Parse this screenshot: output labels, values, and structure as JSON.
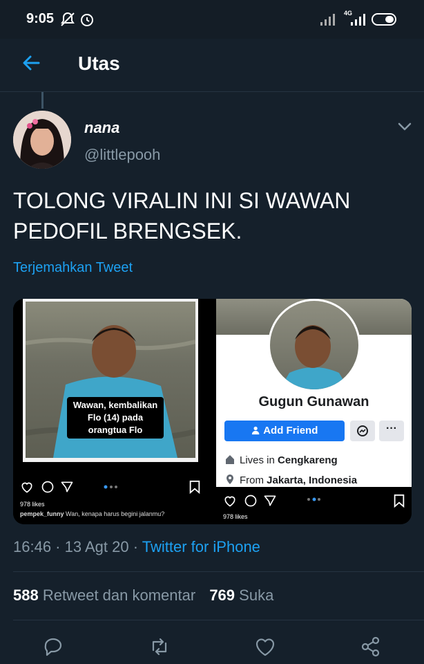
{
  "status_bar": {
    "time": "9:05",
    "network": "4G"
  },
  "header": {
    "title": "Utas",
    "back_icon": "arrow-left-icon"
  },
  "tweet": {
    "author_name": "nana",
    "author_handle": "@littlepooh",
    "text": "TOLONG VIRALIN INI SI WAWAN PEDOFIL BRENGSEK.",
    "translate_label": "Terjemahkan Tweet",
    "timestamp": "16:46 · 13 Agt 20 · ",
    "source": "Twitter for iPhone",
    "retweet_count": "588",
    "retweet_label": "Retweet dan komentar",
    "like_count": "769",
    "like_label": "Suka"
  },
  "media": {
    "left": {
      "caption": "Wawan, kembalikan Flo (14) pada orangtua Flo",
      "likes": "978 likes",
      "comment_user": "pempek_funny",
      "comment_text": "Wan, kenapa harus begini jalanmu?"
    },
    "right": {
      "profile_name": "Gugun Gunawan",
      "add_friend_label": "Add Friend",
      "more_label": "···",
      "lives_prefix": "Lives in ",
      "lives_place": "Cengkareng",
      "from_prefix": "From ",
      "from_place": "Jakarta, Indonesia",
      "likes": "978 likes"
    }
  },
  "colors": {
    "background": "#15202b",
    "accent": "#1da1f2",
    "muted": "#8899a6",
    "fb_blue": "#1877f2"
  }
}
